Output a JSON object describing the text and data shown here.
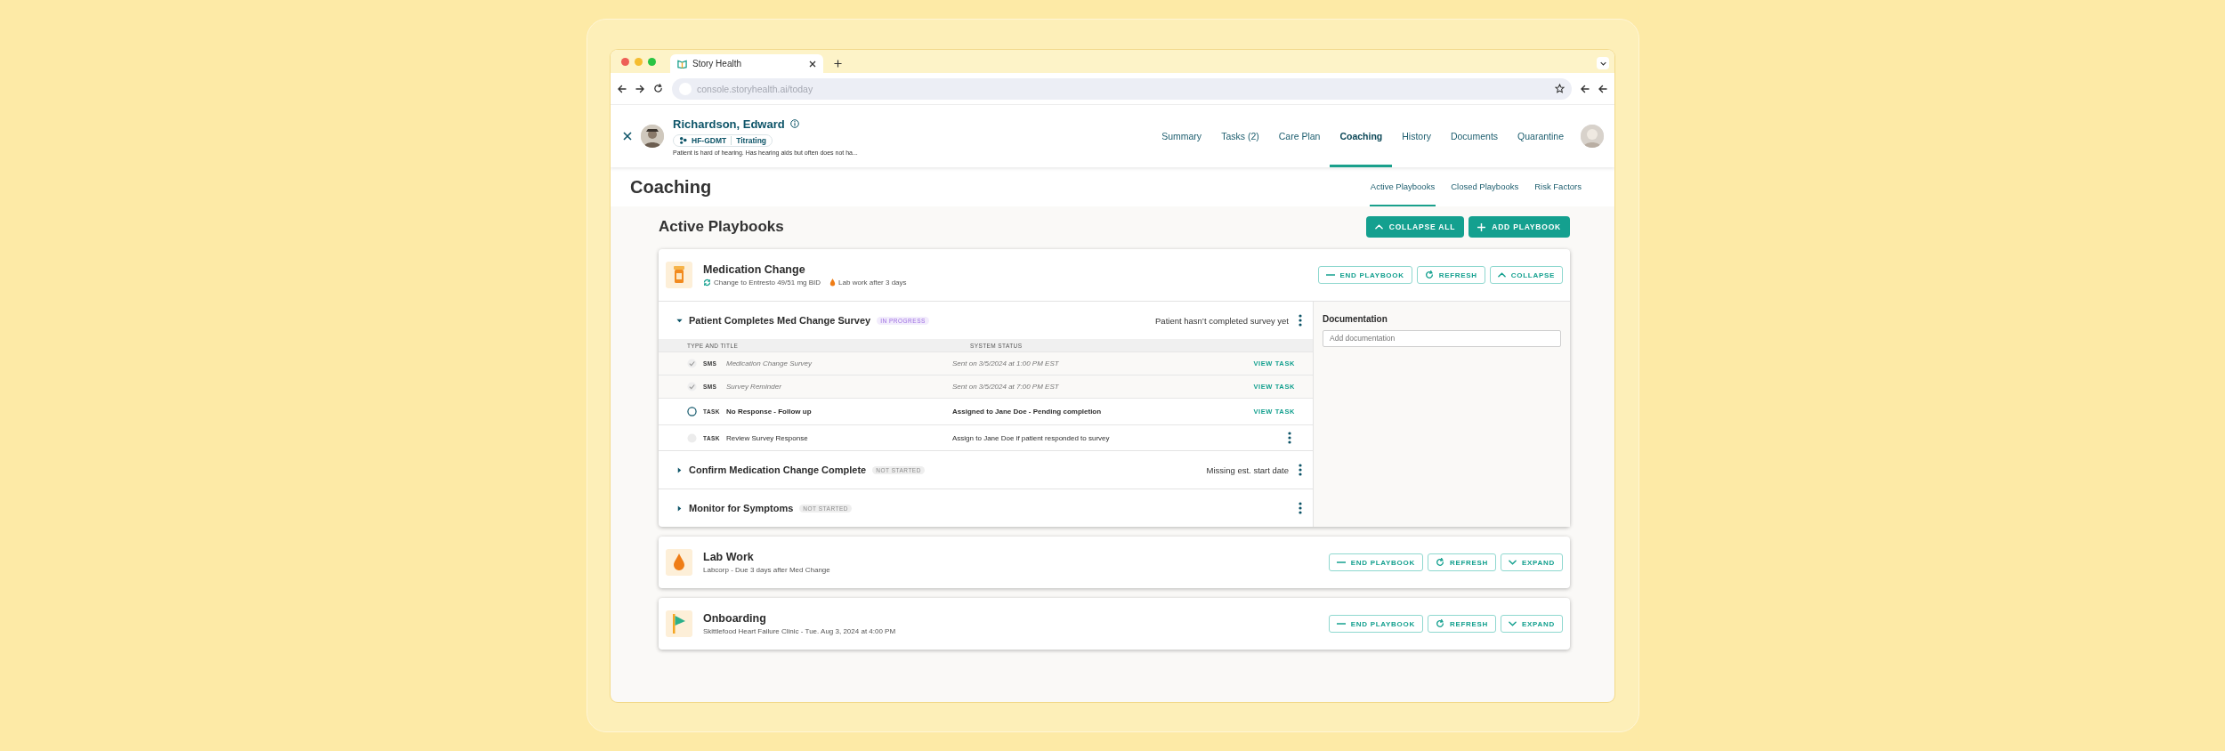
{
  "browser": {
    "tab_title": "Story Health",
    "url": "console.storyhealth.ai/today"
  },
  "patient": {
    "name": "Richardson, Edward",
    "tags": [
      "HF-GDMT",
      "Titrating"
    ],
    "note": "Patient is hard of hearing. Has hearing aids but often does not ha..."
  },
  "nav": [
    {
      "label": "Summary",
      "selected": false
    },
    {
      "label": "Tasks (2)",
      "selected": false
    },
    {
      "label": "Care Plan",
      "selected": false
    },
    {
      "label": "Coaching",
      "selected": true
    },
    {
      "label": "History",
      "selected": false
    },
    {
      "label": "Documents",
      "selected": false
    },
    {
      "label": "Quarantine",
      "selected": false
    }
  ],
  "page": {
    "title": "Coaching",
    "tabs": [
      {
        "label": "Active Playbooks",
        "selected": true
      },
      {
        "label": "Closed Playbooks",
        "selected": false
      },
      {
        "label": "Risk Factors",
        "selected": false
      }
    ]
  },
  "section": {
    "title": "Active Playbooks",
    "buttons": [
      {
        "kind": "collapse",
        "label": "COLLAPSE ALL"
      },
      {
        "kind": "add",
        "label": "ADD PLAYBOOK"
      }
    ]
  },
  "playbooks": [
    {
      "kind": "pill",
      "title": "Medication Change",
      "expanded": true,
      "details": [
        {
          "kind": "cycle",
          "text": "Change to Entresto 49/51 mg BID"
        },
        {
          "kind": "drop",
          "text": "Lab work after 3 days"
        }
      ],
      "actions": [
        {
          "kind": "end",
          "label": "END PLAYBOOK"
        },
        {
          "kind": "refresh",
          "label": "REFRESH"
        },
        {
          "kind": "collapse",
          "label": "COLLAPSE"
        }
      ],
      "steps": [
        {
          "title": "Patient Completes Med Change Survey",
          "status": {
            "kind": "in_progress",
            "label": "IN PROGRESS"
          },
          "note": "Patient hasn’t completed survey yet",
          "expanded": true,
          "columns": [
            "TYPE AND TITLE",
            "SYSTEM STATUS"
          ],
          "tasks": [
            {
              "kind": "done",
              "type": "SMS",
              "title": "Medication Change Survey",
              "status": "Sent on 3/5/2024 at 1:00 PM EST",
              "action": "VIEW TASK"
            },
            {
              "kind": "done",
              "type": "SMS",
              "title": "Survey Reminder",
              "status": "Sent on 3/5/2024 at 7:00 PM EST",
              "action": "VIEW TASK"
            },
            {
              "kind": "active",
              "type": "TASK",
              "title": "No Response - Follow up",
              "status": "Assigned to Jane Doe - Pending completion",
              "action": "VIEW TASK"
            },
            {
              "kind": "upcoming",
              "type": "TASK",
              "title": "Review Survey Response",
              "status": "Assign to Jane Doe if patient responded to survey",
              "menu": true
            }
          ]
        },
        {
          "title": "Confirm Medication Change Complete",
          "status": {
            "kind": "not_started",
            "label": "NOT STARTED"
          },
          "note": "Missing est. start date",
          "expanded": false
        },
        {
          "title": "Monitor for Symptoms",
          "status": {
            "kind": "not_started",
            "label": "NOT STARTED"
          },
          "expanded": false
        }
      ],
      "documentation": {
        "title": "Documentation",
        "placeholder": "Add documentation"
      }
    },
    {
      "kind": "drop",
      "title": "Lab Work",
      "expanded": false,
      "details": [
        {
          "text": "Labcorp - Due 3 days after Med Change"
        }
      ],
      "actions": [
        {
          "kind": "end",
          "label": "END PLAYBOOK"
        },
        {
          "kind": "refresh",
          "label": "REFRESH"
        },
        {
          "kind": "expand",
          "label": "EXPAND"
        }
      ]
    },
    {
      "kind": "flag",
      "title": "Onboarding",
      "expanded": false,
      "details": [
        {
          "text": "Skittlefood Heart Failure Clinic - Tue. Aug 3, 2024 at 4:00 PM"
        }
      ],
      "actions": [
        {
          "kind": "end",
          "label": "END PLAYBOOK"
        },
        {
          "kind": "refresh",
          "label": "REFRESH"
        },
        {
          "kind": "expand",
          "label": "EXPAND"
        }
      ]
    }
  ]
}
